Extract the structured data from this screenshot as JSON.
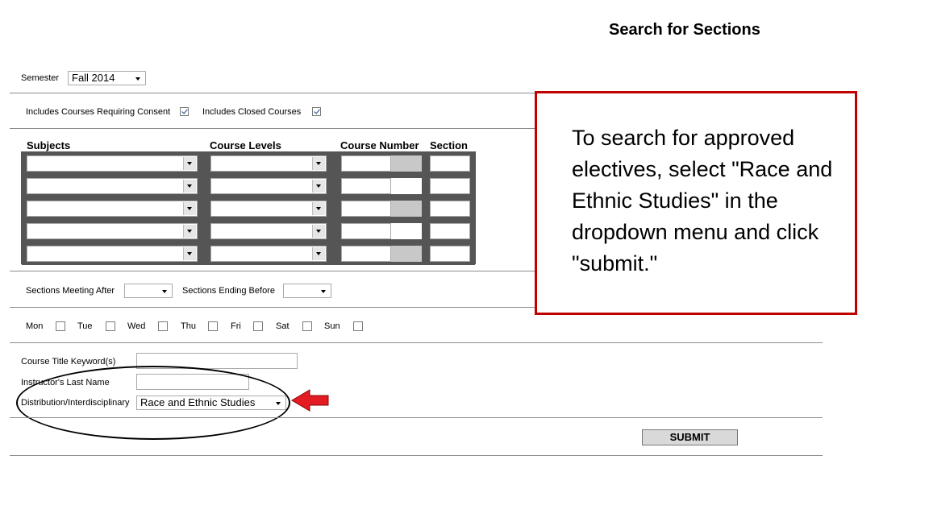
{
  "page": {
    "title": "Search for Sections"
  },
  "semester": {
    "label": "Semester",
    "value": "Fall 2014"
  },
  "options": {
    "consent_label": "Includes Courses Requiring Consent",
    "consent_checked": true,
    "closed_label": "Includes Closed Courses",
    "closed_checked": true
  },
  "grid": {
    "headers": [
      "Subjects",
      "Course Levels",
      "Course Number",
      "Section"
    ],
    "rows": 5
  },
  "time": {
    "after_label": "Sections Meeting After",
    "before_label": "Sections Ending Before"
  },
  "days": [
    "Mon",
    "Tue",
    "Wed",
    "Thu",
    "Fri",
    "Sat",
    "Sun"
  ],
  "keywords": {
    "title_label": "Course Title Keyword(s)",
    "instructor_label": "Instructor's Last Name",
    "distribution_label": "Distribution/Interdisciplinary",
    "distribution_value": "Race and Ethnic Studies"
  },
  "submit_label": "SUBMIT",
  "callout": {
    "text": "To search for approved electives, select \"Race and Ethnic Studies\" in the dropdown menu and click \"submit.\""
  },
  "colors": {
    "callout_border": "#c00000",
    "arrow": "#e31b23"
  }
}
